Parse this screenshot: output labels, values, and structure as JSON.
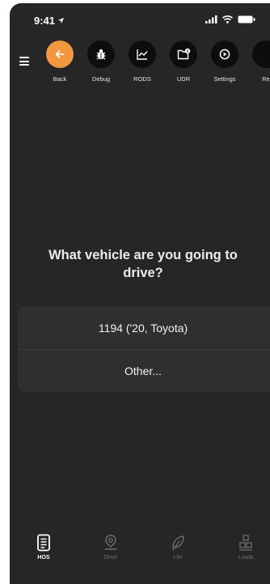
{
  "status_bar": {
    "time": "9:41"
  },
  "toolbar": {
    "items": [
      {
        "label": "Back"
      },
      {
        "label": "Debug"
      },
      {
        "label": "RODS"
      },
      {
        "label": "UDR"
      },
      {
        "label": "Settings"
      },
      {
        "label": "Re"
      }
    ]
  },
  "main": {
    "question": "What vehicle are you going to drive?",
    "options": [
      {
        "label": "1194 ('20, Toyota)"
      },
      {
        "label": "Other..."
      }
    ]
  },
  "tabbar": {
    "items": [
      {
        "label": "HOS",
        "active": true
      },
      {
        "label": "Drive",
        "active": false
      },
      {
        "label": "Life",
        "active": false
      },
      {
        "label": "Loads",
        "active": false
      }
    ]
  },
  "colors": {
    "accent": "#f0973f",
    "background": "#262626"
  }
}
